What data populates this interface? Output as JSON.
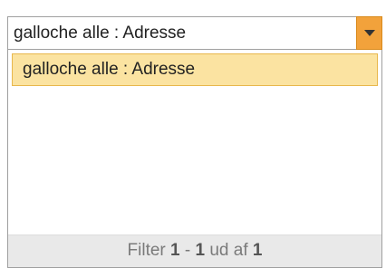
{
  "combo": {
    "value": "galloche alle : Adresse"
  },
  "dropdown": {
    "items": [
      {
        "label": "galloche alle : Adresse",
        "selected": true
      }
    ],
    "footer": {
      "prefix": "Filter",
      "start": "1",
      "dash": "-",
      "end": "1",
      "of_text": "ud af",
      "total": "1"
    }
  },
  "colors": {
    "accent_button": "#f2a23b",
    "selected_item_bg": "#fbe3a1",
    "selected_item_border": "#e8b74d",
    "footer_bg": "#e9e9e9"
  },
  "icons": {
    "dropdown_button": "caret-down-icon"
  }
}
